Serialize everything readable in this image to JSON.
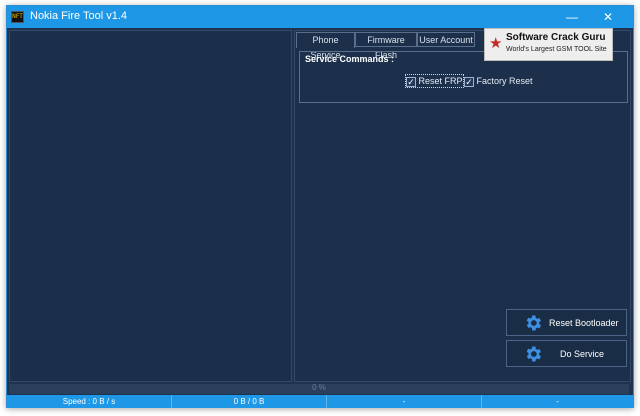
{
  "window": {
    "title": "Nokia Fire Tool v1.4",
    "icon": "app-icon",
    "icon_text": "NFT",
    "minimize": "—",
    "close": "✕"
  },
  "tabs": [
    {
      "label": "Phone Service",
      "active": true
    },
    {
      "label": "Firmware Flash",
      "active": false
    },
    {
      "label": "User Account",
      "active": false
    }
  ],
  "service_commands": {
    "label": "Service Commands :",
    "options": [
      {
        "label": "Reset FRP",
        "checked": true
      },
      {
        "label": "Factory Reset",
        "checked": true
      }
    ]
  },
  "watermark": {
    "title": "Software Crack Guru",
    "subtitle": "World's Largest GSM TOOL Site"
  },
  "buttons": {
    "reset_bootloader": "Reset Bootloader",
    "do_service": "Do Service"
  },
  "progress": {
    "text": "0 %",
    "value": 0
  },
  "status": {
    "speed": "Speed : 0 B / s",
    "transferred": "0 B / 0 B",
    "field3": "-",
    "field4": "-"
  },
  "colors": {
    "titlebar": "#1e98e6",
    "background": "#1f3350",
    "gear": "#3f8fe0"
  }
}
